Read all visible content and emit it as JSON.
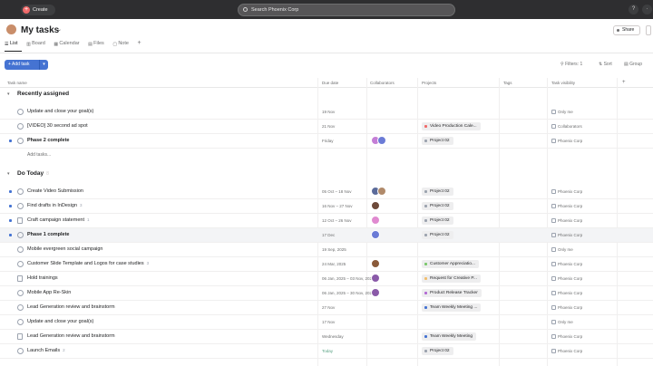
{
  "topbar": {
    "create_label": "Create",
    "search_placeholder": "Search Phoenix Corp"
  },
  "header": {
    "title": "My tasks",
    "share_label": "Share",
    "tabs": [
      {
        "label": "List",
        "icon": "list-icon"
      },
      {
        "label": "Board",
        "icon": "board-icon"
      },
      {
        "label": "Calendar",
        "icon": "calendar-icon"
      },
      {
        "label": "Files",
        "icon": "files-icon"
      },
      {
        "label": "Note",
        "icon": "note-icon"
      }
    ]
  },
  "toolbar": {
    "add_task_label": "Add task",
    "filters_label": "Filters: 1",
    "sort_label": "Sort",
    "group_label": "Group"
  },
  "columns": {
    "task_name": "Task name",
    "due_date": "Due date",
    "collaborators": "Collaborators",
    "projects": "Projects",
    "tags": "Tags",
    "visibility": "Task visibility"
  },
  "sections": [
    {
      "title": "Recently assigned",
      "count": "",
      "add_tasks": "Add tasks...",
      "rows": [
        {
          "name": "Update and close your goal(s)",
          "meta": "",
          "bold": false,
          "due": "19 Nov",
          "due_green": false,
          "avatars": [],
          "project": "",
          "project_color": "",
          "visibility": "Only me",
          "highlight": false,
          "marker": false,
          "icon": "check"
        },
        {
          "name": "[VIDEO] 30 second ad spot",
          "meta": "",
          "bold": false,
          "due": "21 Nov",
          "due_green": false,
          "avatars": [],
          "project": "Video Production Cale...",
          "project_color": "#f06a6a",
          "visibility": "Collaborators",
          "highlight": false,
          "marker": false,
          "icon": "check"
        },
        {
          "name": "Phase 2 complete",
          "meta": "",
          "bold": true,
          "due": "Friday",
          "due_green": false,
          "avatars": [
            "#c47ed6",
            "#6b7bd6"
          ],
          "project": "Project 02",
          "project_color": "#9ca3af",
          "visibility": "Phoenix Corp",
          "highlight": false,
          "marker": true,
          "icon": "check"
        }
      ]
    },
    {
      "title": "Do Today",
      "count": "8",
      "add_tasks": "",
      "rows": [
        {
          "name": "Create Video Submission",
          "meta": "",
          "bold": false,
          "due": "05 Oct – 18 Nov",
          "due_green": false,
          "avatars": [
            "#5b6b9a",
            "#b08a6a"
          ],
          "project": "Project 02",
          "project_color": "#9ca3af",
          "visibility": "Phoenix Corp",
          "highlight": false,
          "marker": true,
          "icon": "check"
        },
        {
          "name": "Find drafts in InDesign",
          "meta": "3",
          "bold": false,
          "due": "16 Nov – 27 Nov",
          "due_green": false,
          "avatars": [
            "#6d4a3a"
          ],
          "project": "Project 02",
          "project_color": "#9ca3af",
          "visibility": "Phoenix Corp",
          "highlight": false,
          "marker": true,
          "icon": "check"
        },
        {
          "name": "Craft campaign statement",
          "meta": "1",
          "bold": false,
          "due": "12 Oct – 26 Nov",
          "due_green": false,
          "avatars": [
            "#e08ad0"
          ],
          "project": "Project 02",
          "project_color": "#9ca3af",
          "visibility": "Phoenix Corp",
          "highlight": false,
          "marker": true,
          "icon": "sub"
        },
        {
          "name": "Phase 1 complete",
          "meta": "",
          "bold": true,
          "due": "17 Dec",
          "due_green": false,
          "avatars": [
            "#6b7bd6"
          ],
          "project": "Project 02",
          "project_color": "#9ca3af",
          "visibility": "Phoenix Corp",
          "highlight": true,
          "marker": true,
          "icon": "check"
        },
        {
          "name": "Mobile evergreen social campaign",
          "meta": "",
          "bold": false,
          "due": "19 Sep, 2025",
          "due_green": false,
          "avatars": [],
          "project": "",
          "project_color": "",
          "visibility": "Only me",
          "highlight": false,
          "marker": false,
          "icon": "check"
        },
        {
          "name": "Customer Slide Template and Logos for case studies",
          "meta": "3",
          "bold": false,
          "due": "24 Mar, 2025",
          "due_green": false,
          "avatars": [
            "#8a5a3a"
          ],
          "project": "Customer Appreciatio...",
          "project_color": "#7bc86c",
          "visibility": "Phoenix Corp",
          "highlight": false,
          "marker": false,
          "icon": "check"
        },
        {
          "name": "Hold trainings",
          "meta": "",
          "bold": false,
          "due": "06 Jan, 2025 – 03 Nov, 2025",
          "due_green": false,
          "avatars": [
            "#8a5aa8"
          ],
          "project": "Request for Creative P...",
          "project_color": "#f1bd6c",
          "visibility": "Phoenix Corp",
          "highlight": false,
          "marker": false,
          "icon": "sub"
        },
        {
          "name": "Mobile App Re-Skin",
          "meta": "",
          "bold": false,
          "due": "06 Jan, 2025 – 30 Nov, 2025",
          "due_green": false,
          "avatars": [
            "#8a5aa8"
          ],
          "project": "Product Release Tracker",
          "project_color": "#b36bd4",
          "visibility": "Phoenix Corp",
          "highlight": false,
          "marker": false,
          "icon": "check"
        },
        {
          "name": "Lead Generation review and brainstorm",
          "meta": "",
          "bold": false,
          "due": "27 Nov",
          "due_green": false,
          "avatars": [],
          "project": "Team Weekly Meeting ...",
          "project_color": "#4573d2",
          "visibility": "Phoenix Corp",
          "highlight": false,
          "marker": false,
          "icon": "check"
        },
        {
          "name": "Update and close your goal(s)",
          "meta": "",
          "bold": false,
          "due": "17 Nov",
          "due_green": false,
          "avatars": [],
          "project": "",
          "project_color": "",
          "visibility": "Only me",
          "highlight": false,
          "marker": false,
          "icon": "check"
        },
        {
          "name": "Lead Generation review and brainstorm",
          "meta": "",
          "bold": false,
          "due": "Wednesday",
          "due_green": false,
          "avatars": [],
          "project": "Team Weekly Meeting",
          "project_color": "#4573d2",
          "visibility": "Phoenix Corp",
          "highlight": false,
          "marker": false,
          "icon": "sub"
        },
        {
          "name": "Launch Emails",
          "meta": "2",
          "bold": false,
          "due": "Today",
          "due_green": true,
          "avatars": [],
          "project": "Project 02",
          "project_color": "#9ca3af",
          "visibility": "Phoenix Corp",
          "highlight": false,
          "marker": false,
          "icon": "check"
        }
      ]
    }
  ]
}
